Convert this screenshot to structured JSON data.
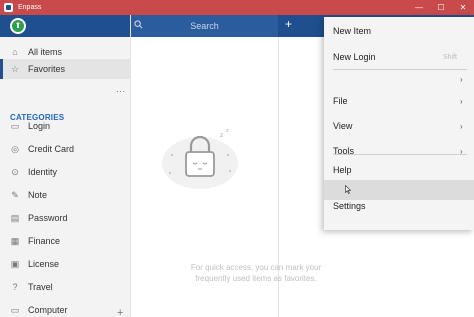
{
  "window": {
    "title": "Enpass",
    "controls": {
      "minimize": "—",
      "maximize": "☐",
      "close": "✕"
    }
  },
  "sidebar": {
    "logo_glyph": "⬆",
    "items": [
      {
        "label": "All items",
        "icon": "home-icon"
      },
      {
        "label": "Favorites",
        "icon": "star-icon"
      }
    ],
    "more": "···",
    "categories_heading": "CATEGORIES",
    "categories": [
      {
        "label": "Login",
        "icon": "login-icon"
      },
      {
        "label": "Credit Card",
        "icon": "credit-card-icon"
      },
      {
        "label": "Identity",
        "icon": "identity-icon"
      },
      {
        "label": "Note",
        "icon": "note-icon"
      },
      {
        "label": "Password",
        "icon": "password-icon"
      },
      {
        "label": "Finance",
        "icon": "finance-icon"
      },
      {
        "label": "License",
        "icon": "license-icon"
      },
      {
        "label": "Travel",
        "icon": "travel-icon"
      },
      {
        "label": "Computer",
        "icon": "computer-icon"
      }
    ],
    "add": "+"
  },
  "search": {
    "placeholder": "Search"
  },
  "toolbar": {
    "add": "+"
  },
  "empty_state": {
    "message": "For quick access, you can mark your frequently used items as favorites."
  },
  "menu": {
    "items": [
      {
        "label": "New Item",
        "shortcut": "",
        "arrow": ""
      },
      {
        "label": "New Login",
        "shortcut": "Shift",
        "arrow": ""
      },
      {
        "label": "",
        "shortcut": "",
        "arrow": "›"
      },
      {
        "label": "File",
        "shortcut": "",
        "arrow": "›"
      },
      {
        "label": "View",
        "shortcut": "",
        "arrow": "›"
      },
      {
        "label": "Tools",
        "shortcut": "",
        "arrow": "›"
      },
      {
        "label": "Help",
        "shortcut": "",
        "arrow": ""
      },
      {
        "label": "",
        "shortcut": "",
        "arrow": ""
      },
      {
        "label": "Settings",
        "shortcut": "",
        "arrow": ""
      }
    ]
  },
  "colors": {
    "titlebar": "#c84a4a",
    "brand": "#1f4f8f",
    "accent": "#1f66c2",
    "logo": "#2e9e4f"
  }
}
